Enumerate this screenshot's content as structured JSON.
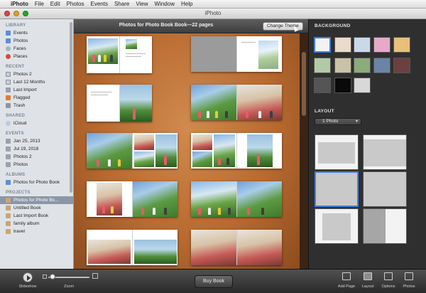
{
  "menubar": {
    "app_name": "iPhoto",
    "items": [
      "File",
      "Edit",
      "Photos",
      "Events",
      "Share",
      "View",
      "Window",
      "Help"
    ]
  },
  "window": {
    "title": "iPhoto"
  },
  "sidebar": {
    "sections": [
      {
        "label": "LIBRARY",
        "items": [
          {
            "label": "Events",
            "icon": "events-icon"
          },
          {
            "label": "Photos",
            "icon": "photos-icon"
          },
          {
            "label": "Faces",
            "icon": "faces-icon"
          },
          {
            "label": "Places",
            "icon": "places-icon"
          }
        ]
      },
      {
        "label": "RECENT",
        "items": [
          {
            "label": "Photos 2",
            "icon": "calendar-icon"
          },
          {
            "label": "Last 12 Months",
            "icon": "calendar-icon"
          },
          {
            "label": "Last Import",
            "icon": "import-icon"
          },
          {
            "label": "Flagged",
            "icon": "flag-icon"
          },
          {
            "label": "Trash",
            "icon": "trash-icon"
          }
        ]
      },
      {
        "label": "SHARED",
        "items": [
          {
            "label": "iCloud",
            "icon": "icloud-icon"
          }
        ]
      },
      {
        "label": "EVENTS",
        "items": [
          {
            "label": "Jan 25, 2013",
            "icon": "event-icon"
          },
          {
            "label": "Jul 19, 2018",
            "icon": "event-icon"
          },
          {
            "label": "Photos 2",
            "icon": "event-icon"
          },
          {
            "label": "Photos",
            "icon": "event-icon"
          }
        ]
      },
      {
        "label": "ALBUMS",
        "items": [
          {
            "label": "Photos for Photo Book",
            "icon": "album-icon"
          }
        ]
      },
      {
        "label": "PROJECTS",
        "items": [
          {
            "label": "Photos for Photo Bo...",
            "icon": "book-icon",
            "selected": true
          },
          {
            "label": "Untitled Book",
            "icon": "book-icon"
          },
          {
            "label": "Last Import Book",
            "icon": "book-icon"
          },
          {
            "label": "family album",
            "icon": "book-icon"
          },
          {
            "label": "travel",
            "icon": "book-icon"
          }
        ]
      }
    ]
  },
  "main": {
    "title": "Photos for Photo Book Book—22 pages",
    "change_theme_label": "Change Theme"
  },
  "inspector": {
    "background_label": "BACKGROUND",
    "layout_label": "LAYOUT",
    "layout_select_value": "1 Photo",
    "background_colors": [
      "#f2f2f2",
      "#e9dcc8",
      "#c9d9e8",
      "#e8a9c9",
      "#e8c079",
      "#b2c9a8",
      "#c9c2a6",
      "#8cab7c",
      "#6b84a6",
      "#6b4040",
      "#555555",
      "#0a0a0a",
      "#d8d8d8"
    ]
  },
  "toolbar": {
    "slideshow_label": "Slideshow",
    "zoom_label": "Zoom",
    "buy_book_label": "Buy Book",
    "add_page_label": "Add Page",
    "layout_label": "Layout",
    "options_label": "Options",
    "photos_label": "Photos"
  }
}
